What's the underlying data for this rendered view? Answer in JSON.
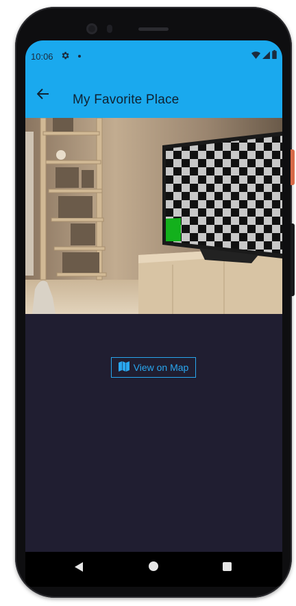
{
  "status_bar": {
    "time": "10:06",
    "settings_icon": "gear-icon",
    "notification_dot": "dot-icon",
    "wifi_icon": "wifi-icon",
    "signal_icon": "signal-icon",
    "battery_icon": "battery-icon"
  },
  "app_bar": {
    "back_icon": "arrow-left-icon",
    "title": "My Favorite Place",
    "background_color": "#1aa9ee"
  },
  "hero_image": {
    "description_icon": "room-photo"
  },
  "content": {
    "view_map_button_label": "View on Map",
    "map_icon": "map-icon",
    "accent_color": "#29a7f0",
    "background_color": "#201e31"
  },
  "nav_bar": {
    "back_icon": "triangle-back-icon",
    "home_icon": "circle-home-icon",
    "recents_icon": "square-recents-icon"
  }
}
